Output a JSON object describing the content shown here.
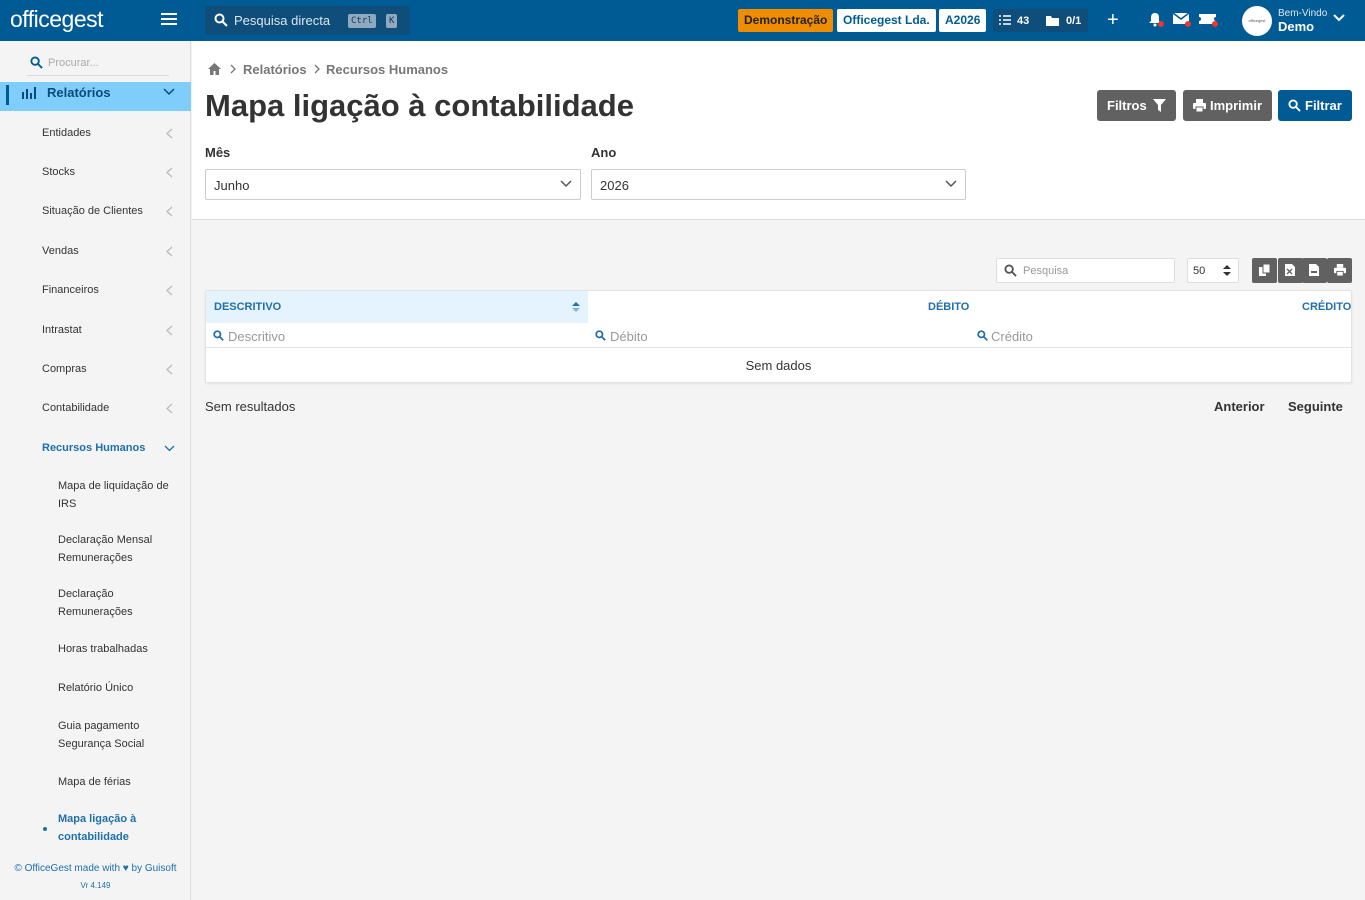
{
  "topbar": {
    "logo": "officegest",
    "search_placeholder": "Pesquisa directa",
    "shortcut_ctrl": "Ctrl",
    "shortcut_k": "K",
    "badge_demo": "Demonstração",
    "badge_company": "Officegest Lda.",
    "badge_year": "A2026",
    "tasks_count": "43",
    "folder_count": "0/1",
    "welcome": "Bem-Vindo",
    "username": "Demo",
    "avatar_text": "officegest"
  },
  "sidebar": {
    "search_placeholder": "Procurar...",
    "section": "Relatórios",
    "items": [
      {
        "label": "Entidades"
      },
      {
        "label": "Stocks"
      },
      {
        "label": "Situação de Clientes"
      },
      {
        "label": "Vendas"
      },
      {
        "label": "Financeiros"
      },
      {
        "label": "Intrastat"
      },
      {
        "label": "Compras"
      },
      {
        "label": "Contabilidade"
      },
      {
        "label": "Recursos Humanos"
      }
    ],
    "subitems": [
      {
        "label": "Mapa de liquidação de IRS"
      },
      {
        "label": "Declaração Mensal Remunerações"
      },
      {
        "label": "Declaração Remunerações"
      },
      {
        "label": "Horas trabalhadas"
      },
      {
        "label": "Relatório Único"
      },
      {
        "label": "Guia pagamento Segurança Social"
      },
      {
        "label": "Mapa de férias"
      },
      {
        "label": "Mapa ligação à contabilidade"
      }
    ],
    "footer": "© OfficeGest made with ♥ by Guisoft",
    "version": "Vr 4.149"
  },
  "breadcrumb": [
    "Relatórios",
    "Recursos Humanos"
  ],
  "page_title": "Mapa ligação à contabilidade",
  "buttons": {
    "filtros": "Filtros",
    "imprimir": "Imprimir",
    "filtrar": "Filtrar"
  },
  "form": {
    "month_label": "Mês",
    "month_value": "Junho",
    "year_label": "Ano",
    "year_value": "2026"
  },
  "table": {
    "search_placeholder": "Pesquisa",
    "page_size": "50",
    "columns": [
      "DESCRITIVO",
      "DÉBITO",
      "CRÉDITO"
    ],
    "filters": [
      "Descritivo",
      "Débito",
      "Crédito"
    ],
    "empty": "Sem dados",
    "result_text": "Sem resultados",
    "prev": "Anterior",
    "next": "Seguinte"
  },
  "colors": {
    "primary": "#005b94",
    "accent": "#7fcdfb",
    "demo": "#f08c00",
    "button_gray": "#616161"
  }
}
